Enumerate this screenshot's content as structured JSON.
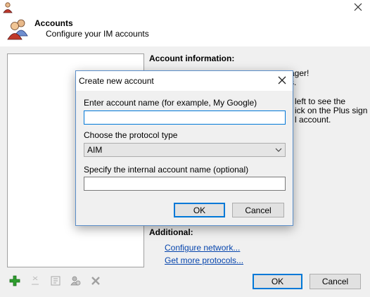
{
  "header": {
    "title": "Accounts",
    "subtitle": "Configure your IM accounts"
  },
  "info": {
    "title": "Account information:",
    "bg_lines": [
      "ager!",
      "s.",
      "left to see the",
      "ick on the Plus sign",
      "l account."
    ]
  },
  "additional": {
    "title": "Additional:",
    "links": [
      "Configure network...",
      "Get more protocols..."
    ]
  },
  "toolbar": {
    "icons": [
      "add-icon",
      "rename-icon",
      "properties-icon",
      "protocol-icon",
      "delete-icon"
    ]
  },
  "buttons": {
    "ok": "OK",
    "cancel": "Cancel"
  },
  "dialog": {
    "title": "Create new account",
    "name_label": "Enter account name (for example, My Google)",
    "name_value": "",
    "protocol_label": "Choose the protocol type",
    "protocol_selected": "AIM",
    "internal_label": "Specify the internal account name (optional)",
    "internal_value": "",
    "ok": "OK",
    "cancel": "Cancel"
  },
  "colors": {
    "link": "#0645ad",
    "focus": "#0078d7",
    "add_icon": "#2e9e2e"
  }
}
